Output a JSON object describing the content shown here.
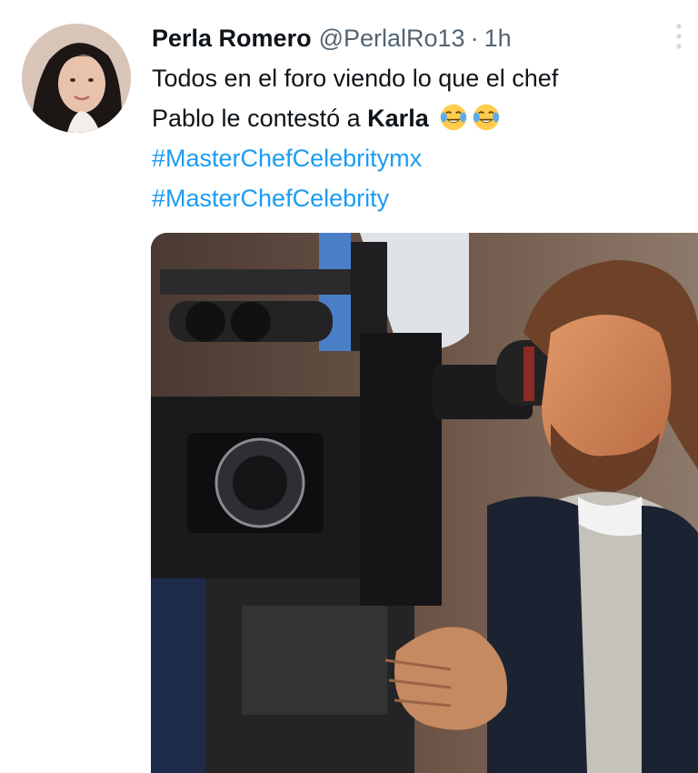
{
  "tweet": {
    "author": {
      "display_name": "Perla Romero",
      "handle": "@PerlalRo13",
      "separator": "·",
      "time_ago": "1h"
    },
    "text_line1": "Todos en el foro viendo lo que el chef",
    "text_line2_prefix": "Pablo le contestó a ",
    "text_line2_bold": "Karla",
    "emojis": [
      "face-with-tears-of-joy-icon",
      "face-with-tears-of-joy-icon"
    ],
    "hashtags": [
      "#MasterChefCelebritymx",
      "#MasterChefCelebrity"
    ],
    "media": {
      "type": "photo",
      "subject": "man-looking-through-film-camera"
    }
  },
  "colors": {
    "text": "#0f1419",
    "secondary_text": "#536471",
    "link": "#1d9bf0",
    "background": "#ffffff"
  }
}
